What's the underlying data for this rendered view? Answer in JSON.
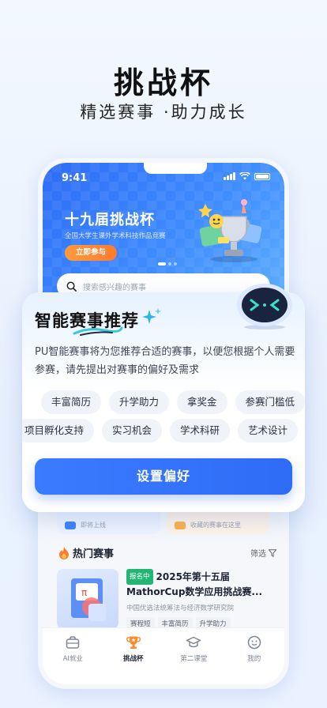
{
  "hero": {
    "title": "挑战杯",
    "subtitle": "精选赛事 ·助力成长"
  },
  "status_bar": {
    "time": "9:41"
  },
  "banner": {
    "title": "十九届挑战杯",
    "description": "全国大学生课外学术科技作品竞赛",
    "button_label": "立即参与",
    "page_count": 3,
    "active_page": 1
  },
  "search": {
    "placeholder": "搜索感兴趣的赛事"
  },
  "mini_cards": [
    {
      "caption": "即将上线",
      "icon": "blue-folder-icon"
    },
    {
      "caption": "收藏的赛事在这里",
      "icon": "star-folder-icon"
    }
  ],
  "hot": {
    "title": "热门赛事",
    "filter_label": "筛选"
  },
  "contest": {
    "status": "报名中",
    "title": "2025年第十五届MathorCup数学应用挑战赛...",
    "organizer": "中国优选法统筹法与经济数学研究院",
    "tags": [
      "赛程短",
      "丰富简历",
      "升学助力"
    ]
  },
  "tabbar": {
    "items": [
      {
        "label": "AI就业",
        "icon": "briefcase-icon",
        "active": false
      },
      {
        "label": "挑战杯",
        "icon": "trophy-icon",
        "active": true
      },
      {
        "label": "第二课堂",
        "icon": "graduation-cap-icon",
        "active": false
      },
      {
        "label": "我的",
        "icon": "smiley-icon",
        "active": false
      }
    ]
  },
  "recommend": {
    "title": "智能赛事推荐",
    "description": "PU智能赛事将为您推荐合适的赛事，以便您根据个人需要参赛，请先提出对赛事的偏好及需求",
    "chips_row1": [
      "丰富简历",
      "升学助力",
      "拿奖金",
      "参赛门槛低"
    ],
    "chips_row2": [
      "项目孵化支持",
      "实习机会",
      "学术科研",
      "艺术设计"
    ],
    "button_label": "设置偏好"
  },
  "colors": {
    "primary": "#2f6cf6",
    "accent_orange": "#ff7a2e",
    "status_green": "#22b573"
  }
}
